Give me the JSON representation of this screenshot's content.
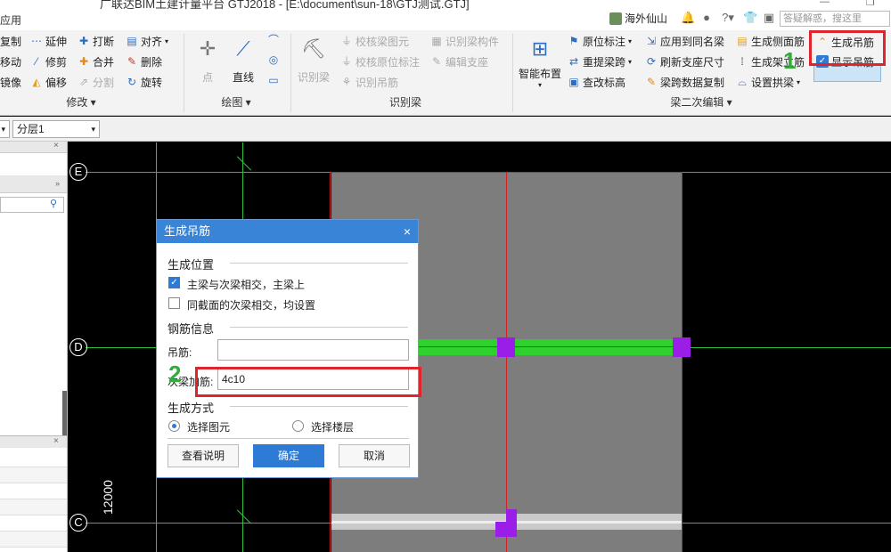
{
  "titlebar": {
    "app_fragment": "应用",
    "title": "广联达BIM土建计量平台 GTJ2018 - [E:\\document\\sun-18\\GTJ测试.GTJ]",
    "user": "海外仙山",
    "search_placeholder": "答疑解惑，搜这里"
  },
  "ribbon": {
    "modify": {
      "group": "修改",
      "items": [
        "复制",
        "延伸",
        "打断",
        "对齐",
        "移动",
        "修剪",
        "合并",
        "删除",
        "镜像",
        "偏移",
        "分割",
        "旋转"
      ]
    },
    "draw": {
      "group": "绘图",
      "point": "点",
      "line": "直线"
    },
    "recognize": {
      "group": "识别梁",
      "big": "识别梁",
      "items": [
        "校核梁图元",
        "识别梁构件",
        "校核原位标注",
        "编辑支座",
        "识别吊筋"
      ]
    },
    "edit2": {
      "group": "梁二次编辑",
      "smart": "智能布置",
      "items": [
        "原位标注",
        "应用到同名梁",
        "生成侧面筋",
        "生成吊筋",
        "重提梁跨",
        "刷新支座尺寸",
        "生成架立筋",
        "显示吊筋",
        "查改标高",
        "梁跨数据复制",
        "设置拱梁"
      ]
    },
    "step1_marker": "1"
  },
  "toolrow": {
    "layer": "分层1"
  },
  "canvas": {
    "axes": [
      "E",
      "D",
      "C"
    ],
    "dimension": "12000"
  },
  "dialog": {
    "title": "生成吊筋",
    "section_position": "生成位置",
    "opt_main_secondary": "主梁与次梁相交，主梁上",
    "opt_same_section": "同截面的次梁相交，均设置",
    "section_rebar": "钢筋信息",
    "hang_label": "吊筋:",
    "hang_value": "",
    "extra_label": "次梁加筋:",
    "extra_value": "4c10",
    "section_method": "生成方式",
    "radio_select_element": "选择图元",
    "radio_select_floor": "选择楼层",
    "btn_help": "查看说明",
    "btn_ok": "确定",
    "btn_cancel": "取消",
    "step2_marker": "2"
  }
}
